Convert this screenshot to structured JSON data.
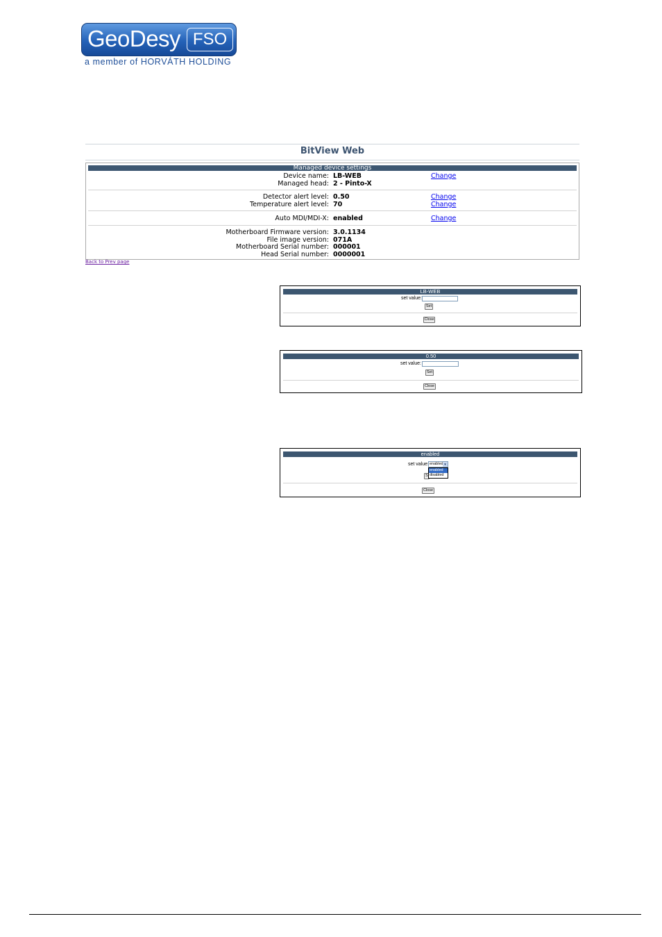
{
  "logo": {
    "brand_main": "GeoDesy",
    "brand_sub": "FSO",
    "tagline": "a member of HORVÁTH HOLDING"
  },
  "app": {
    "title": "BitView Web",
    "panel_title": "Managed device settings",
    "rows": [
      {
        "label": "Device name:",
        "value": "LB-WEB",
        "action": "Change"
      },
      {
        "label": "Managed head:",
        "value": "2 - Pinto-X",
        "action": ""
      },
      {
        "label": "Detector alert level:",
        "value": "0.50",
        "action": "Change"
      },
      {
        "label": "Temperature alert level:",
        "value": "70",
        "action": "Change"
      },
      {
        "label": "Auto MDI/MDI-X:",
        "value": "enabled",
        "action": "Change"
      },
      {
        "label": "Motherboard Firmware version:",
        "value": "3.0.1134",
        "action": ""
      },
      {
        "label": "File image version:",
        "value": "071A",
        "action": ""
      },
      {
        "label": "Motherboard Serial number:",
        "value": "000001",
        "action": ""
      },
      {
        "label": "Head Serial number:",
        "value": "0000001",
        "action": ""
      }
    ],
    "back_link": "Back to Prev page"
  },
  "dialogs": {
    "name": {
      "title": "LB-WEB",
      "label": "set value:",
      "value": "",
      "set": "Set",
      "close": "Close"
    },
    "detector": {
      "title": "0.50",
      "label": "set value:",
      "value": "",
      "set": "Set",
      "close": "Close"
    },
    "mdi": {
      "title": "enabled",
      "label": "set value:",
      "selected": "enabled",
      "options": [
        "enabled",
        "disabled"
      ],
      "set": "S",
      "close": "Close"
    }
  },
  "colors": {
    "header_bar": "#3c5670",
    "title_text": "#3d5470",
    "link": "#0000ee",
    "brand_blue": "#2462b8"
  }
}
